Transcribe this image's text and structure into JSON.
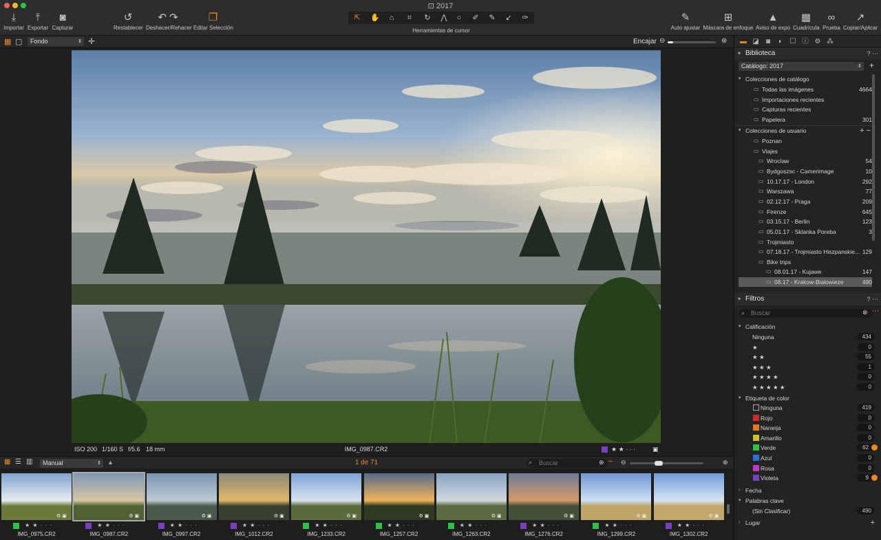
{
  "window": {
    "title": "2017"
  },
  "toolbar": {
    "left": [
      {
        "label": "Importar",
        "icon": "⤓"
      },
      {
        "label": "Exportar",
        "icon": "⤒"
      },
      {
        "label": "Capturar",
        "icon": "◙"
      }
    ],
    "edit": [
      {
        "label": "Restablecer",
        "icon": "↺"
      },
      {
        "label": "Deshacer/Rehacer",
        "icon": "↶ ↷"
      },
      {
        "label": "Editar Selección",
        "icon": "❐"
      }
    ],
    "cursor_tools_label": "Herramientas de cursor",
    "right": [
      {
        "label": "Auto ajustar",
        "icon": "✎"
      },
      {
        "label": "Máscara de enfoque",
        "icon": "⊞"
      },
      {
        "label": "Aviso de expo",
        "icon": "▲"
      },
      {
        "label": "Cuadrícula",
        "icon": "▦"
      },
      {
        "label": "Prueba",
        "icon": "∞"
      },
      {
        "label": "Copiar/Aplicar",
        "icon": "↗"
      }
    ]
  },
  "viewer": {
    "background_select": "Fondo",
    "fit_label": "Encajar",
    "zoom_level": 0.12,
    "photo": {
      "iso": "ISO 200",
      "shutter": "1/160 S",
      "aperture": "f/5.6",
      "focal": "18 mm",
      "filename": "IMG_0987.CR2",
      "stars": "★ ★ · · ·",
      "color_tag": "#7a3fc0"
    }
  },
  "browser": {
    "sort": "Manual",
    "page_count": "1 de 71",
    "search_placeholder": "Buscar",
    "thumb_size": 0.38,
    "thumbs": [
      {
        "name": "IMG_0975.CR2",
        "tag": "#2fc04a",
        "stars": "★ ★ · · ·"
      },
      {
        "name": "IMG_0987.CR2",
        "tag": "#7a3fc0",
        "stars": "★ ★ · · ·"
      },
      {
        "name": "IMG_0997.CR2",
        "tag": "#7a3fc0",
        "stars": "★ ★ · · ·"
      },
      {
        "name": "IMG_1012.CR2",
        "tag": "#7a3fc0",
        "stars": "★ ★ · · ·"
      },
      {
        "name": "IMG_1233.CR2",
        "tag": "#2fc04a",
        "stars": "★ ★ · · ·"
      },
      {
        "name": "IMG_1257.CR2",
        "tag": "#2fc04a",
        "stars": "★ ★ · · ·"
      },
      {
        "name": "IMG_1263.CR2",
        "tag": "#2fc04a",
        "stars": "★ ★ · · ·"
      },
      {
        "name": "IMG_1276.CR2",
        "tag": "#7a3fc0",
        "stars": "★ ★ · · ·"
      },
      {
        "name": "IMG_1299.CR2",
        "tag": "#2fc04a",
        "stars": "★ ★ · · ·"
      },
      {
        "name": "IMG_1302.CR2",
        "tag": "#7a3fc0",
        "stars": "★ ★ · · ·"
      }
    ]
  },
  "library": {
    "title": "Biblioteca",
    "catalog": "Catálogo: 2017",
    "catalog_collections": {
      "title": "Colecciones de catálogo",
      "items": [
        {
          "label": "Todas las imágenes",
          "count": "4664"
        },
        {
          "label": "Importaciones recientes",
          "count": ""
        },
        {
          "label": "Capturas recientes",
          "count": ""
        },
        {
          "label": "Papelera",
          "count": "301"
        }
      ]
    },
    "user_collections": {
      "title": "Colecciones de usuario",
      "items": [
        {
          "label": "Poznan",
          "count": ""
        },
        {
          "label": "Viajes",
          "count": ""
        },
        {
          "label": "Wroclaw",
          "count": "54"
        },
        {
          "label": "Bydgoszsc - Camerimage",
          "count": "10"
        },
        {
          "label": "10.17.17 - London",
          "count": "292"
        },
        {
          "label": "Warszawa",
          "count": "77"
        },
        {
          "label": "02.12.17 - Praga",
          "count": "209"
        },
        {
          "label": "Firenze",
          "count": "645"
        },
        {
          "label": "03.15.17 - Berlin",
          "count": "123"
        },
        {
          "label": "05.01.17 - Sklanka Poreba",
          "count": "3"
        },
        {
          "label": "Trojmiasto",
          "count": ""
        },
        {
          "label": "07.18.17 - Trojmiasto Hiszpanskie...",
          "count": "129"
        },
        {
          "label": "Bike trips",
          "count": ""
        },
        {
          "label": "08.01.17 - Kujawe",
          "count": "147"
        },
        {
          "label": "08.17 - Krakow-Bialowieze",
          "count": "490"
        }
      ]
    }
  },
  "filters": {
    "title": "Filtros",
    "search_placeholder": "Buscar",
    "rating": {
      "title": "Calificación",
      "items": [
        {
          "label": "Ninguna",
          "count": "434"
        },
        {
          "label": "★",
          "count": "0"
        },
        {
          "label": "★ ★",
          "count": "55"
        },
        {
          "label": "★ ★ ★",
          "count": "1"
        },
        {
          "label": "★ ★ ★ ★",
          "count": "0"
        },
        {
          "label": "★ ★ ★ ★ ★",
          "count": "0"
        }
      ]
    },
    "color_label": {
      "title": "Etiqueta de color",
      "items": [
        {
          "label": "Ninguna",
          "count": "419",
          "color": "none"
        },
        {
          "label": "Rojo",
          "count": "0",
          "color": "#d02a2a"
        },
        {
          "label": "Naranja",
          "count": "0",
          "color": "#e07a1f"
        },
        {
          "label": "Amarillo",
          "count": "0",
          "color": "#c8c22a"
        },
        {
          "label": "Verde",
          "count": "62",
          "color": "#2fc04a"
        },
        {
          "label": "Azul",
          "count": "0",
          "color": "#2a6fd0"
        },
        {
          "label": "Rosa",
          "count": "0",
          "color": "#c03ac0"
        },
        {
          "label": "Violeta",
          "count": "9",
          "color": "#7a3fc0"
        }
      ]
    },
    "date_title": "Fecha",
    "keywords": {
      "title": "Palabras clave",
      "items": [
        {
          "label": "(Sin Clasificar)",
          "count": "490"
        }
      ]
    },
    "place_title": "Lugar"
  },
  "colors": {
    "accent": "#e8862a",
    "panel": "#232323"
  }
}
